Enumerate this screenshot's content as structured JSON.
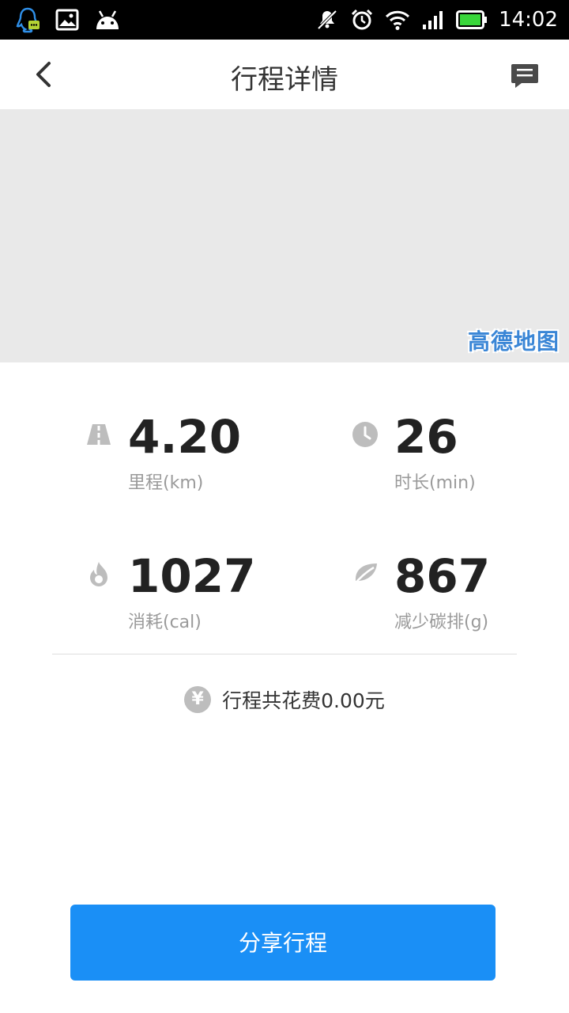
{
  "status_bar": {
    "time": "14:02",
    "left_icons": [
      "qq-icon",
      "image-icon",
      "android-icon"
    ],
    "right_icons": [
      "mute-icon",
      "alarm-icon",
      "wifi-icon",
      "signal-icon",
      "battery-icon"
    ]
  },
  "header": {
    "title": "行程详情",
    "back_icon": "chevron-left-icon",
    "message_icon": "message-icon"
  },
  "map": {
    "provider_logo": "高德地图"
  },
  "stats": {
    "distance": {
      "value": "4.20",
      "label": "里程(km)",
      "icon": "road-icon"
    },
    "duration": {
      "value": "26",
      "label": "时长(min)",
      "icon": "clock-icon"
    },
    "calories": {
      "value": "1027",
      "label": "消耗(cal)",
      "icon": "flame-icon"
    },
    "carbon": {
      "value": "867",
      "label": "减少碳排(g)",
      "icon": "leaf-icon"
    }
  },
  "cost": {
    "symbol": "¥",
    "text": "行程共花费0.00元"
  },
  "share_button": {
    "label": "分享行程"
  },
  "colors": {
    "accent": "#1a8ff6",
    "map_bg": "#e9e9e9",
    "icon_gray": "#bdbdbd"
  }
}
